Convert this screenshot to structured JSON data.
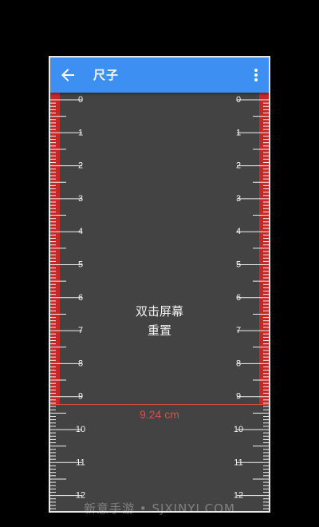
{
  "app_bar": {
    "title": "尺子",
    "back_icon": "arrow-left-icon",
    "menu_icon": "more-vert-icon",
    "color": "#3d8ff2"
  },
  "ruler": {
    "unit": "cm",
    "labels_left": [
      "0",
      "1",
      "2",
      "3",
      "4",
      "5",
      "6",
      "7",
      "8",
      "9",
      "10",
      "11",
      "12"
    ],
    "labels_right": [
      "0",
      "1",
      "2",
      "3",
      "4",
      "5",
      "6",
      "7",
      "8",
      "9",
      "10",
      "11",
      "12"
    ],
    "measured_value": 9.24,
    "measurement_text": "9.24 cm",
    "highlight_color": "#c62828",
    "line_color": "#e24b45"
  },
  "hint": {
    "line1": "双击屏幕",
    "line2": "重置"
  },
  "watermark": "新意手游 • SJXINYI.COM"
}
